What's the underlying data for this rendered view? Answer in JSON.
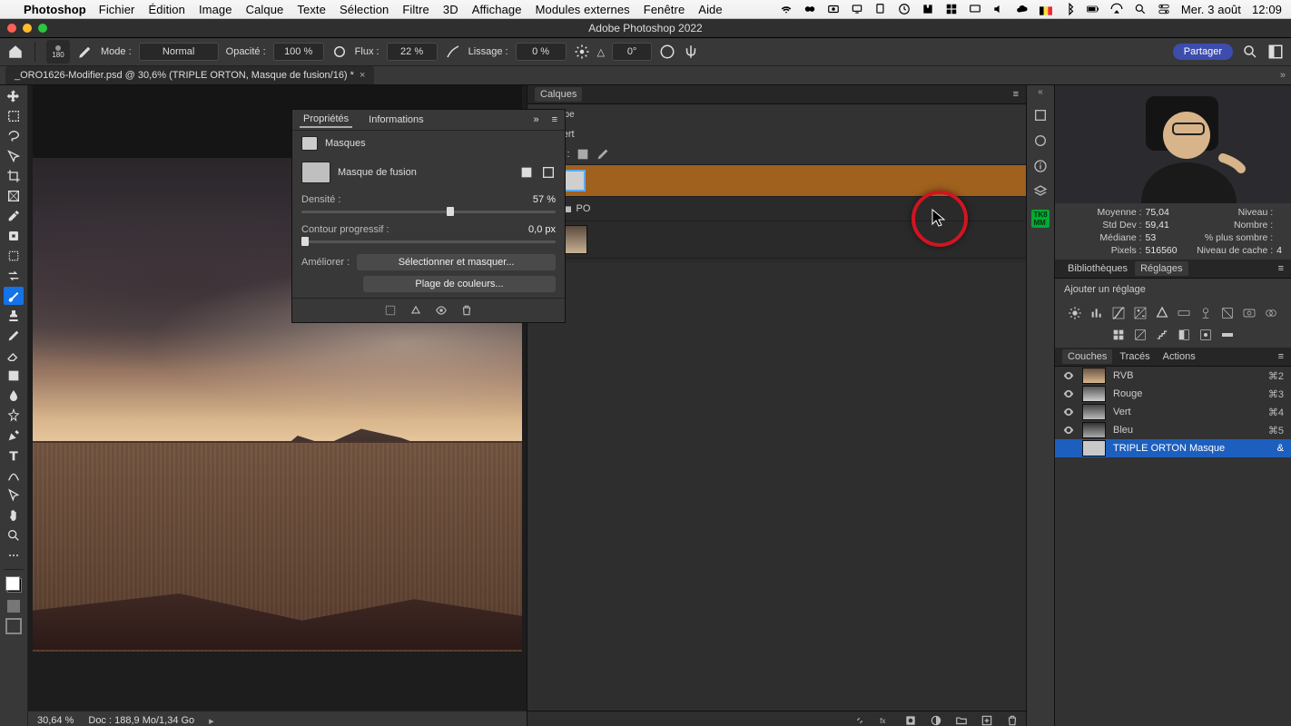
{
  "macmenu": {
    "app": "Photoshop",
    "items": [
      "Fichier",
      "Édition",
      "Image",
      "Calque",
      "Texte",
      "Sélection",
      "Filtre",
      "3D",
      "Affichage",
      "Modules externes",
      "Fenêtre",
      "Aide"
    ],
    "date": "Mer. 3 août",
    "time": "12:09"
  },
  "window": {
    "title": "Adobe Photoshop 2022"
  },
  "optbar": {
    "brushSize": "180",
    "modeLabel": "Mode :",
    "modeValue": "Normal",
    "opacityLabel": "Opacité :",
    "opacityValue": "100 %",
    "flowLabel": "Flux :",
    "flowValue": "22 %",
    "smoothLabel": "Lissage :",
    "smoothValue": "0 %",
    "angleLabel": "△",
    "angleValue": "0°",
    "share": "Partager"
  },
  "doc": {
    "tab": "_ORO1626-Modifier.psd @ 30,6% (TRIPLE ORTON, Masque de fusion/16) *"
  },
  "status": {
    "zoom": "30,64 %",
    "docinfo": "Doc : 188,9 Mo/1,34 Go"
  },
  "layersPanel": {
    "title": "Calques",
    "filter": "Type",
    "blend": "Transfert",
    "lock": "Verrou :",
    "rows": [
      {
        "label": ""
      },
      {
        "label": "PO"
      }
    ]
  },
  "props": {
    "tab1": "Propriétés",
    "tab2": "Informations",
    "section": "Masques",
    "maskType": "Masque de fusion",
    "density": {
      "label": "Densité :",
      "value": "57 %",
      "pct": 57
    },
    "feather": {
      "label": "Contour progressif :",
      "value": "0,0 px",
      "pct": 0
    },
    "refine": "Améliorer :",
    "btn1": "Sélectionner et masquer...",
    "btn2": "Plage de couleurs..."
  },
  "rightTabs": {
    "lib": "Bibliothèques",
    "reg": "Réglages",
    "addAdj": "Ajouter un réglage"
  },
  "stats": {
    "mean": {
      "k": "Moyenne :",
      "v": "75,04"
    },
    "stddev": {
      "k": "Std Dev :",
      "v": "59,41"
    },
    "median": {
      "k": "Médiane :",
      "v": "53"
    },
    "pixels": {
      "k": "Pixels :",
      "v": "516560"
    },
    "level": {
      "k": "Niveau :",
      "v": ""
    },
    "count": {
      "k": "Nombre :",
      "v": ""
    },
    "darker": {
      "k": "% plus sombre :",
      "v": ""
    },
    "cache": {
      "k": "Niveau de cache :",
      "v": "4"
    }
  },
  "channelsPanel": {
    "tabs": [
      "Couches",
      "Tracés",
      "Actions"
    ],
    "rows": [
      {
        "name": "RVB",
        "key": "⌘2"
      },
      {
        "name": "Rouge",
        "key": "⌘3"
      },
      {
        "name": "Vert",
        "key": "⌘4"
      },
      {
        "name": "Bleu",
        "key": "⌘5"
      },
      {
        "name": "TRIPLE ORTON Masque",
        "key": "&",
        "sel": true
      }
    ]
  }
}
